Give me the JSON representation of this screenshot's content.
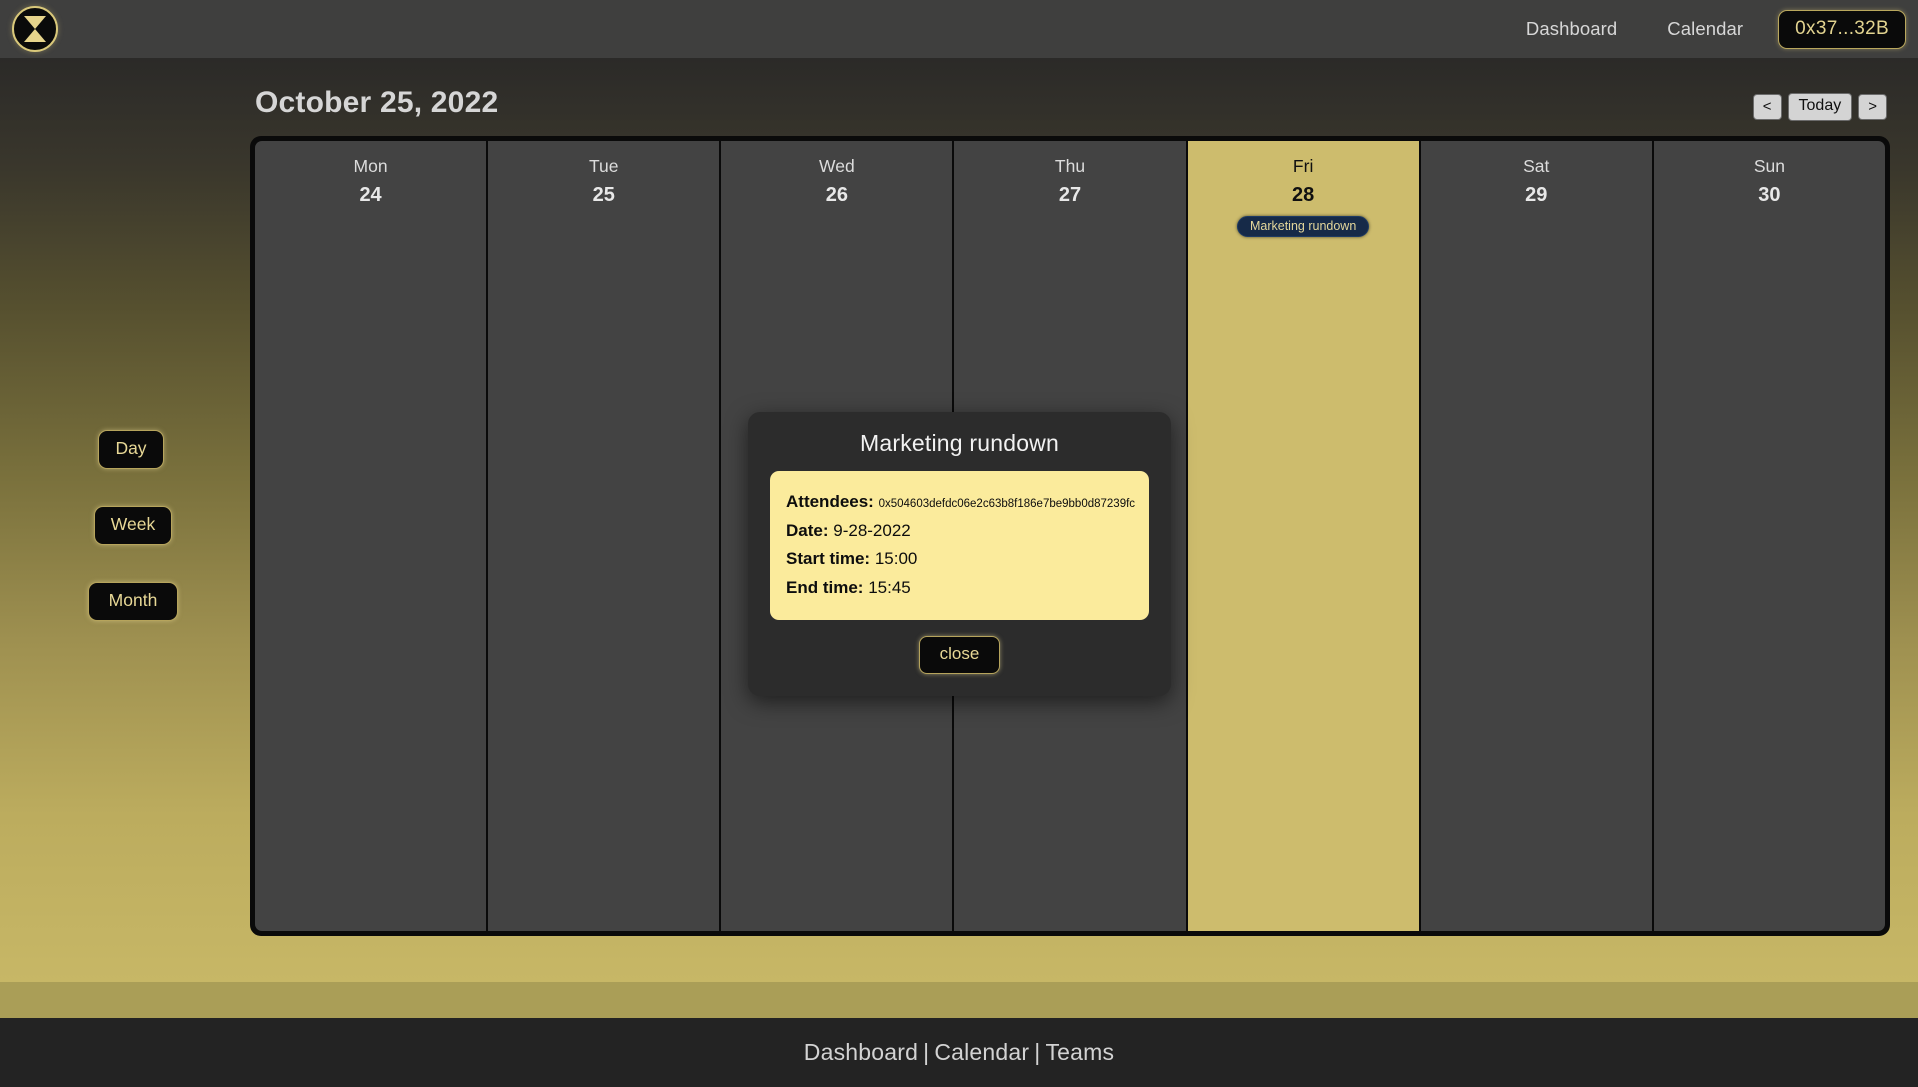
{
  "topbar": {
    "logo_icon": "hourglass-icon",
    "links": [
      {
        "label": "Dashboard"
      },
      {
        "label": "Calendar"
      }
    ],
    "wallet": "0x37...32B",
    "background_color": "#3f3f3e"
  },
  "sidebar": {
    "views": [
      {
        "label": "Day"
      },
      {
        "label": "Week"
      },
      {
        "label": "Month"
      }
    ]
  },
  "calendar": {
    "title": "October 25, 2022",
    "nav": {
      "prev_label": "<",
      "today_label": "Today",
      "next_label": ">"
    },
    "days": [
      {
        "dow": "Mon",
        "num": "24",
        "today": false,
        "events": []
      },
      {
        "dow": "Tue",
        "num": "25",
        "today": false,
        "events": []
      },
      {
        "dow": "Wed",
        "num": "26",
        "today": false,
        "events": []
      },
      {
        "dow": "Thu",
        "num": "27",
        "today": false,
        "events": []
      },
      {
        "dow": "Fri",
        "num": "28",
        "today": true,
        "events": [
          {
            "title": "Marketing rundown"
          }
        ]
      },
      {
        "dow": "Sat",
        "num": "29",
        "today": false,
        "events": []
      },
      {
        "dow": "Sun",
        "num": "30",
        "today": false,
        "events": []
      }
    ],
    "highlight_color": "#cdbc6d",
    "column_color": "#434343"
  },
  "modal": {
    "title": "Marketing rundown",
    "fields": [
      {
        "label": "Attendees:",
        "value": "0x504603defdc06e2c63b8f186e7be9bb0d87239fc",
        "tiny": true
      },
      {
        "label": "Date:",
        "value": "9-28-2022",
        "tiny": false
      },
      {
        "label": "Start time:",
        "value": "15:00",
        "tiny": false
      },
      {
        "label": "End time:",
        "value": "15:45",
        "tiny": false
      }
    ],
    "close_label": "close",
    "card_color": "#fbeb9c"
  },
  "footer": {
    "links": [
      {
        "label": "Dashboard"
      },
      {
        "label": "Calendar"
      },
      {
        "label": "Teams"
      }
    ],
    "separator": "|"
  }
}
